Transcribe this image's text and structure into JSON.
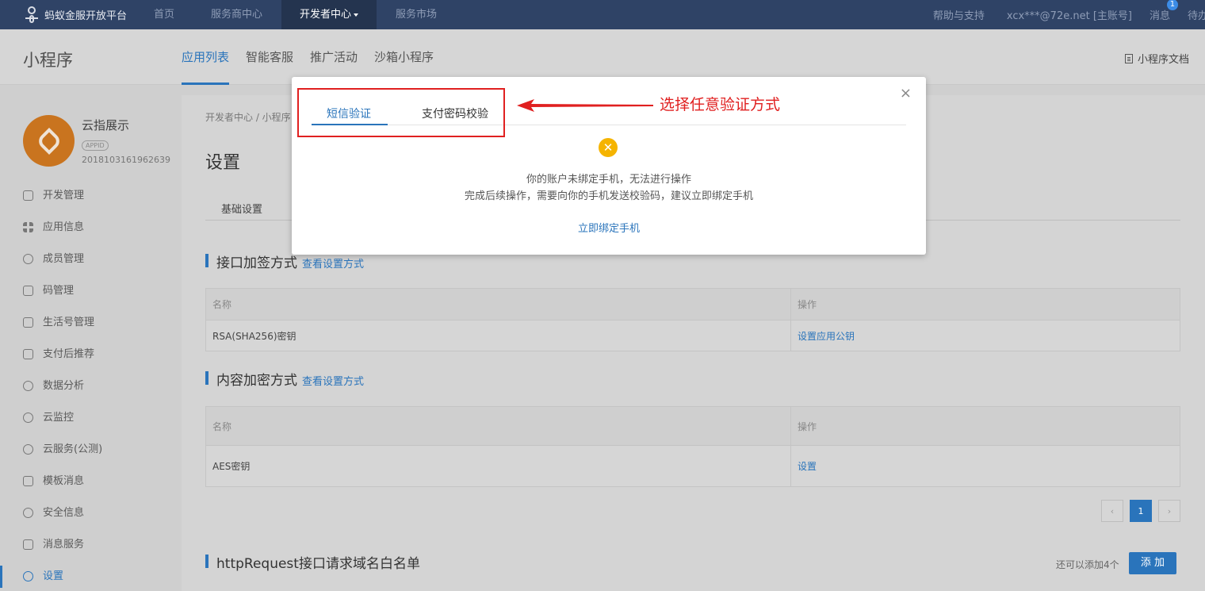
{
  "topnav": {
    "logo_text": "蚂蚁金服开放平台",
    "items": [
      {
        "label": "首页"
      },
      {
        "label": "服务商中心"
      },
      {
        "label": "开发者中心"
      },
      {
        "label": "服务市场"
      }
    ],
    "right": {
      "help": "帮助与支持",
      "account": "xcx***@72e.net [主账号]",
      "messages": "消息",
      "messages_badge": "1",
      "todo": "待办"
    }
  },
  "subheader": {
    "title": "小程序",
    "tabs": [
      {
        "label": "应用列表"
      },
      {
        "label": "智能客服"
      },
      {
        "label": "推广活动"
      },
      {
        "label": "沙箱小程序"
      }
    ],
    "doc_link": "小程序文档"
  },
  "sidebar": {
    "app_name": "云指展示",
    "app_tag": "APPID",
    "app_id": "2018103161962639",
    "items": [
      {
        "label": "开发管理",
        "icon": "code-icon"
      },
      {
        "label": "应用信息",
        "icon": "grid-icon"
      },
      {
        "label": "成员管理",
        "icon": "user-icon"
      },
      {
        "label": "码管理",
        "icon": "qrcode-icon"
      },
      {
        "label": "生活号管理",
        "icon": "life-icon"
      },
      {
        "label": "支付后推荐",
        "icon": "monitor-icon"
      },
      {
        "label": "数据分析",
        "icon": "pie-icon"
      },
      {
        "label": "云监控",
        "icon": "cloud-icon"
      },
      {
        "label": "云服务(公测)",
        "icon": "cloud-service-icon"
      },
      {
        "label": "模板消息",
        "icon": "message-icon"
      },
      {
        "label": "安全信息",
        "icon": "shield-icon"
      },
      {
        "label": "消息服务",
        "icon": "chart-icon"
      },
      {
        "label": "设置",
        "icon": "gear-icon"
      }
    ]
  },
  "main": {
    "breadcrumb": "开发者中心 / 小程序",
    "page_title": "设置",
    "tab": "基础设置",
    "section1": {
      "title": "接口加签方式",
      "link": "查看设置方式"
    },
    "table1": {
      "headers": [
        "名称",
        "操作"
      ],
      "rows": [
        {
          "name": "RSA(SHA256)密钥",
          "action": "设置应用公钥"
        }
      ]
    },
    "section2": {
      "title": "内容加密方式",
      "link": "查看设置方式"
    },
    "table2": {
      "headers": [
        "名称",
        "操作"
      ],
      "rows": [
        {
          "name": "AES密钥",
          "action": "设置"
        }
      ]
    },
    "pager": {
      "prev": "‹",
      "current": "1",
      "next": "›"
    },
    "section3": {
      "title": "httpRequest接口请求域名白名单"
    },
    "add_hint": "还可以添加4个",
    "add_button": "添 加"
  },
  "modal": {
    "close": "×",
    "tabs": [
      {
        "label": "短信验证"
      },
      {
        "label": "支付密码校验"
      }
    ],
    "warn_symbol": "✕",
    "message_line1": "你的账户未绑定手机，无法进行操作",
    "message_line2": "完成后续操作，需要向你的手机发送校验码，建议立即绑定手机",
    "bind_link": "立即绑定手机"
  },
  "annotation": {
    "text": "选择任意验证方式",
    "color": "#e02020"
  },
  "colors": {
    "accent": "#2a74bb",
    "topnav_bg": "#2f4366",
    "warning": "#f5b400"
  }
}
